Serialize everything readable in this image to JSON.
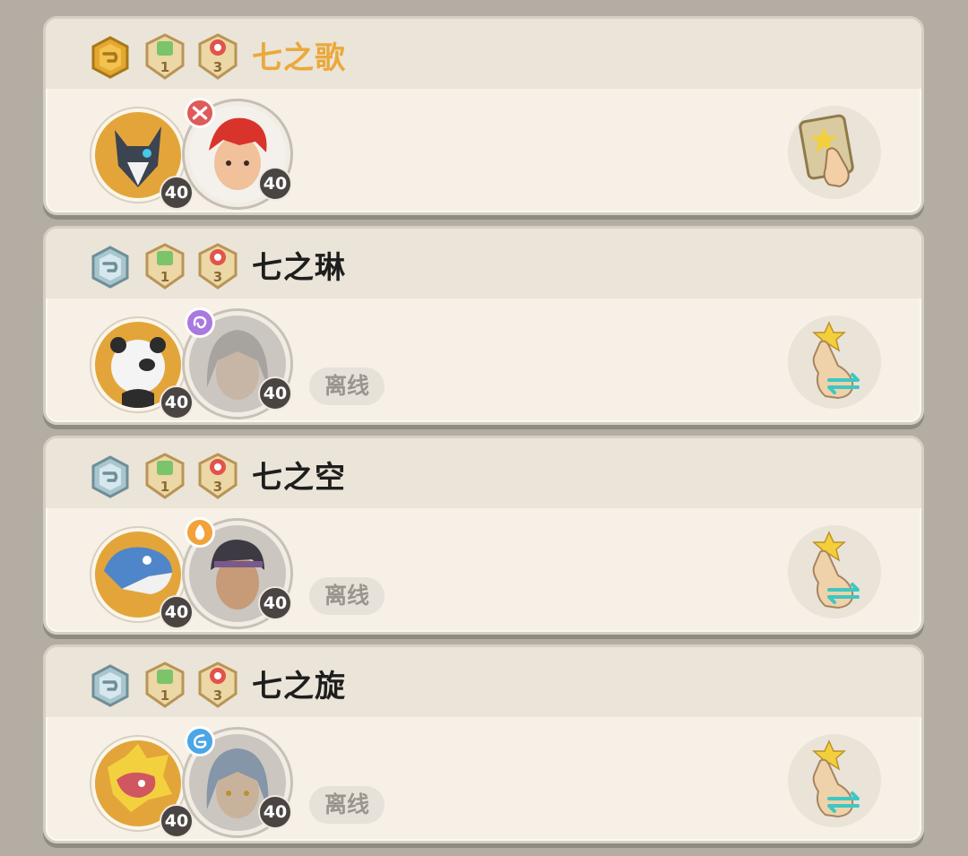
{
  "players": [
    {
      "name": "七之歌",
      "name_color": "#eaa93a",
      "rank_badge": "gold-shield-icon",
      "medals": [
        {
          "icon": "wind-medal-icon",
          "value": "1"
        },
        {
          "icon": "fire-medal-icon",
          "value": "3"
        }
      ],
      "pet": {
        "icon": "wolf-pet-avatar",
        "level": "40"
      },
      "trainer": {
        "icon": "red-hair-trainer-avatar",
        "level": "40",
        "element": "fighting-element-icon",
        "element_color": "#e05a5a"
      },
      "status": "",
      "action": "add-friend-card-icon"
    },
    {
      "name": "七之琳",
      "name_color": "#1e1e1e",
      "rank_badge": "silver-shield-icon",
      "medals": [
        {
          "icon": "wind-medal-icon",
          "value": "1"
        },
        {
          "icon": "fire-medal-icon",
          "value": "3"
        }
      ],
      "pet": {
        "icon": "panda-pet-avatar",
        "level": "40"
      },
      "trainer": {
        "icon": "silver-hair-trainer-avatar",
        "level": "40",
        "element": "psychic-element-icon",
        "element_color": "#a979e0"
      },
      "status": "离线",
      "action": "swap-tap-icon"
    },
    {
      "name": "七之空",
      "name_color": "#1e1e1e",
      "rank_badge": "silver-shield-icon",
      "medals": [
        {
          "icon": "wind-medal-icon",
          "value": "1"
        },
        {
          "icon": "fire-medal-icon",
          "value": "3"
        }
      ],
      "pet": {
        "icon": "blue-dino-pet-avatar",
        "level": "40"
      },
      "trainer": {
        "icon": "headband-trainer-avatar",
        "level": "40",
        "element": "fire-element-icon",
        "element_color": "#f2a23a"
      },
      "status": "离线",
      "action": "swap-tap-icon"
    },
    {
      "name": "七之旋",
      "name_color": "#1e1e1e",
      "rank_badge": "silver-shield-icon",
      "medals": [
        {
          "icon": "wind-medal-icon",
          "value": "1"
        },
        {
          "icon": "fire-medal-icon",
          "value": "3"
        }
      ],
      "pet": {
        "icon": "yellow-dragon-pet-avatar",
        "level": "40"
      },
      "trainer": {
        "icon": "blue-hair-trainer-avatar",
        "level": "40",
        "element": "water-element-icon",
        "element_color": "#4aa6e6"
      },
      "status": "离线",
      "action": "swap-tap-icon"
    }
  ]
}
